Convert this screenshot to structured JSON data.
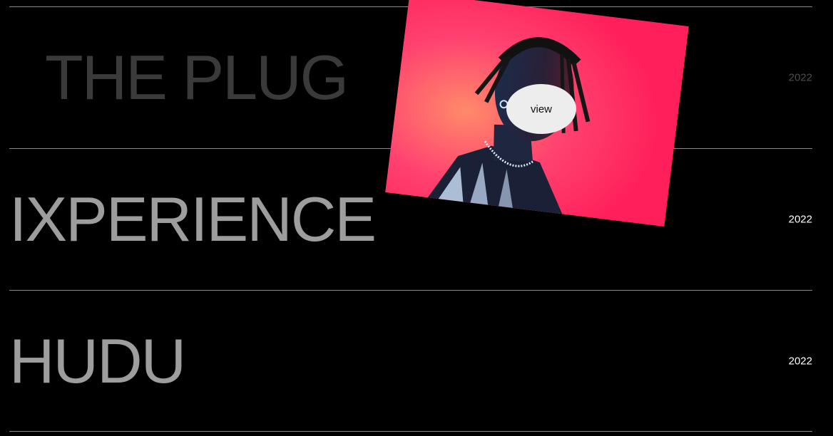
{
  "projects": [
    {
      "title": "THE PLUG",
      "year": "2022"
    },
    {
      "title": "IXPERIENCE",
      "year": "2022"
    },
    {
      "title": "HUDU",
      "year": "2022"
    }
  ],
  "preview": {
    "cta_label": "view"
  },
  "colors": {
    "background": "#000000",
    "divider": "#8a8a8a",
    "title_active": "#9d9d9d",
    "title_dimmed": "#3a3a3a",
    "preview_bg": "#ff2b5e"
  }
}
